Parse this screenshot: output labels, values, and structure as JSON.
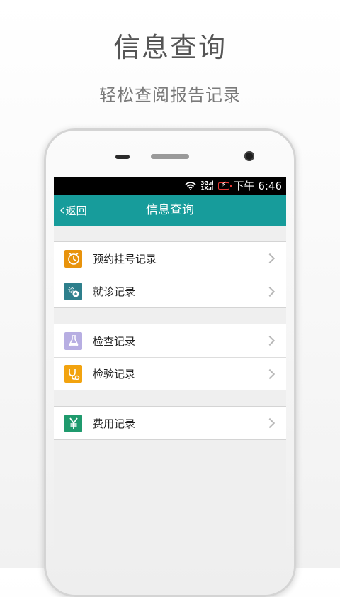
{
  "promo": {
    "title": "信息查询",
    "subtitle": "轻松查阅报告记录"
  },
  "status_bar": {
    "network_top": "3G",
    "network_bottom": "1X",
    "time": "下午 6:46"
  },
  "header": {
    "back_label": "返回",
    "title": "信息查询"
  },
  "groups": [
    {
      "items": [
        {
          "label": "预约挂号记录",
          "icon": "appointment-clock-icon",
          "color": "#e8930c"
        },
        {
          "label": "就诊记录",
          "icon": "consultation-icon",
          "color": "#2e7f8c"
        }
      ]
    },
    {
      "items": [
        {
          "label": "检查记录",
          "icon": "flask-icon",
          "color": "#b7aee2"
        },
        {
          "label": "检验记录",
          "icon": "stethoscope-icon",
          "color": "#f2a30f"
        }
      ]
    },
    {
      "items": [
        {
          "label": "费用记录",
          "icon": "yuan-icon",
          "color": "#1f9a6d"
        }
      ]
    }
  ],
  "colors": {
    "header": "#179c9b",
    "status_bar": "#000000",
    "screen_bg": "#efefef",
    "battery": "#e53935"
  }
}
